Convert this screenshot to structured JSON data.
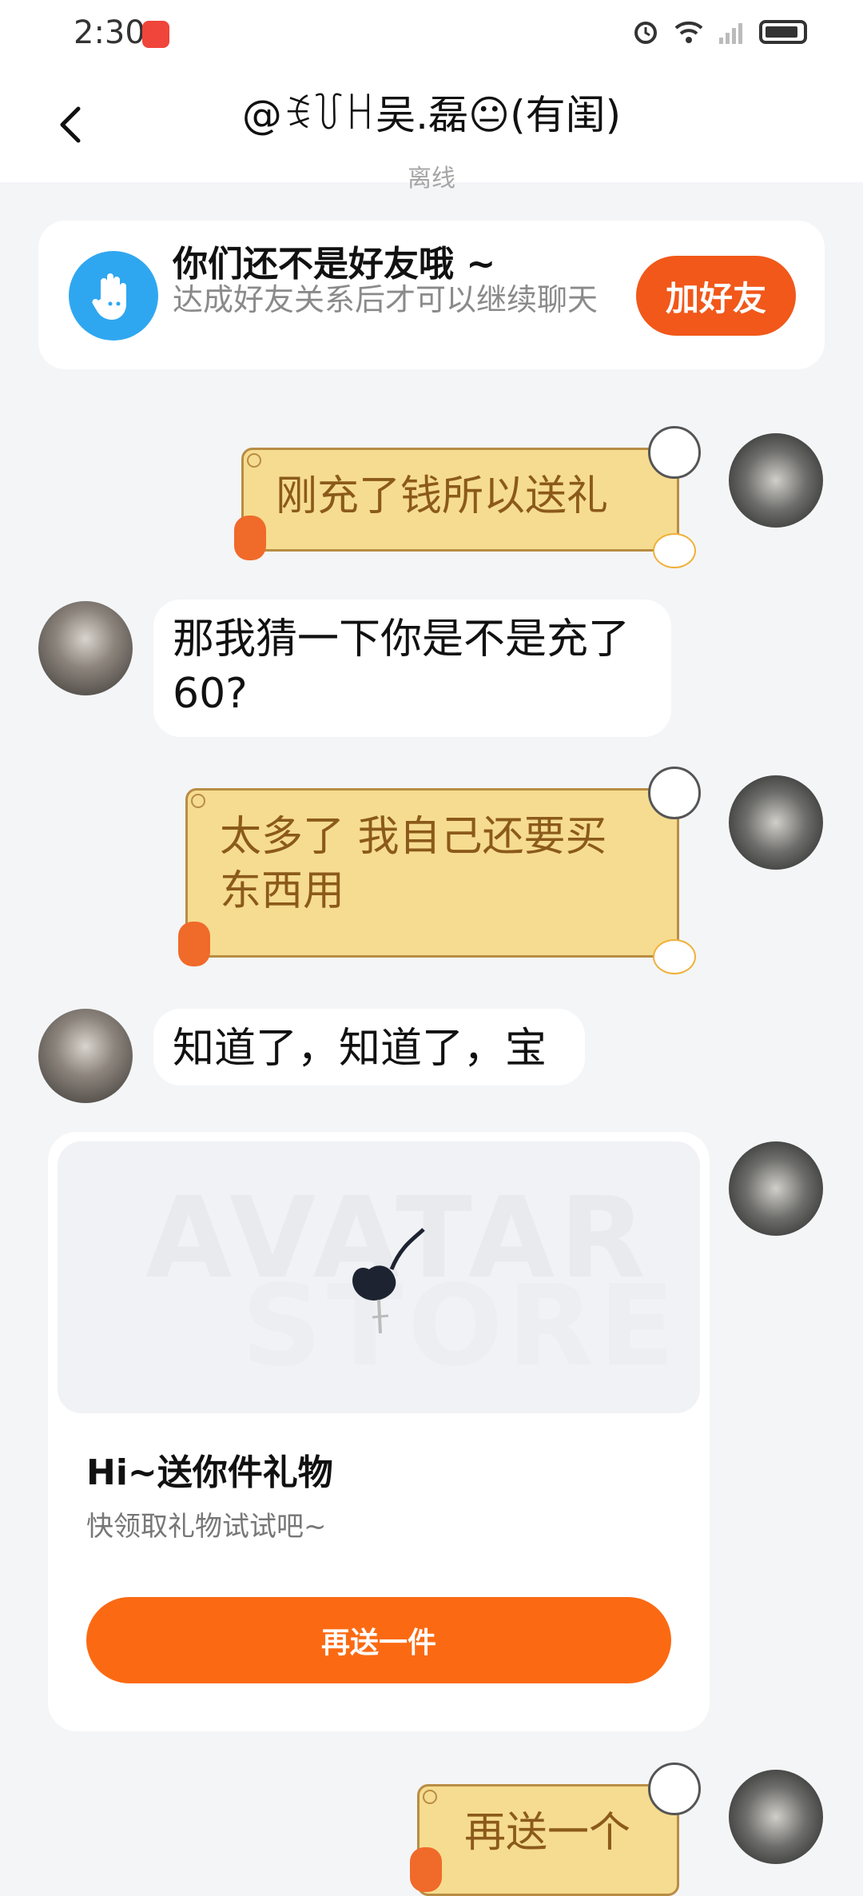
{
  "status": {
    "time": "2:30"
  },
  "header": {
    "title": "@ꉂ꒦ꀿ吴.磊😐(有闺)",
    "subtitle": "离线"
  },
  "friend_notice": {
    "title": "你们还不是好友哦 ~",
    "description": "达成好友关系后才可以继续聊天",
    "button": "加好友"
  },
  "messages": [
    {
      "side": "right",
      "text": "刚充了钱所以送礼"
    },
    {
      "side": "left",
      "text": "那我猜一下你是不是充了60?"
    },
    {
      "side": "right",
      "text": "太多了 我自己还要买东西用"
    },
    {
      "side": "left",
      "text": "知道了，知道了，宝"
    },
    {
      "side": "right",
      "text": "再送一个"
    }
  ],
  "gift_card": {
    "watermark_top": "AVATAR",
    "watermark_bottom": "STORE",
    "title": "Hi~送你件礼物",
    "subtitle": "快领取礼物试试吧~",
    "button": "再送一件"
  },
  "icons": [
    "back-icon",
    "alarm-icon",
    "wifi-icon",
    "signal-icon",
    "battery-icon",
    "hand-icon",
    "gift-rose-icon"
  ]
}
